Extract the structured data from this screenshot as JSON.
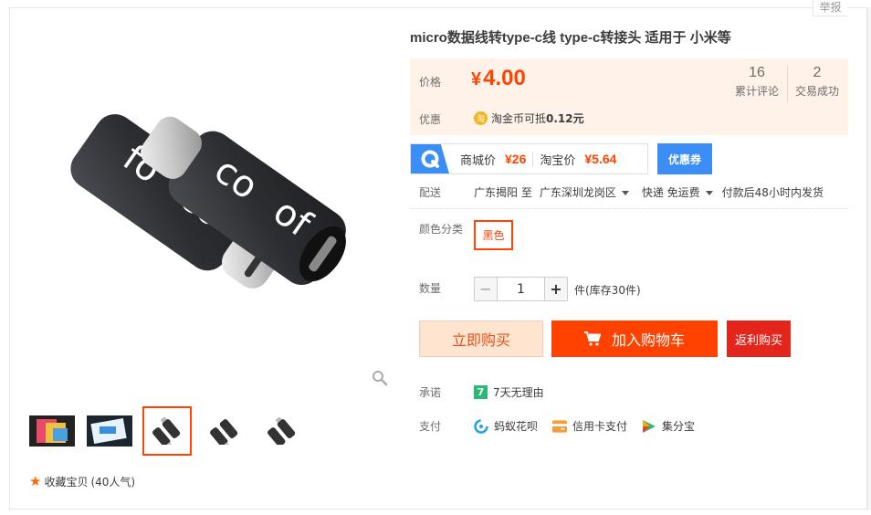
{
  "report_label": "举报",
  "product": {
    "title": "micro数据线转type-c线 type-c转接头 适用于 小米等"
  },
  "gallery": {
    "thumbnails": [
      {
        "name": "thumb-1",
        "active": false
      },
      {
        "name": "thumb-2",
        "active": false
      },
      {
        "name": "thumb-3",
        "active": true
      },
      {
        "name": "thumb-4",
        "active": false
      },
      {
        "name": "thumb-5",
        "active": false
      }
    ],
    "collect_label": "收藏宝贝",
    "collect_count": "(40人气)"
  },
  "price": {
    "label": "价格",
    "currency": "¥",
    "value": "4.00",
    "reviews_count": "16",
    "reviews_label": "累计评论",
    "deals_count": "2",
    "deals_label": "交易成功",
    "promo_label": "优惠",
    "coin_icon": "淘",
    "coin_text": "淘金币可抵",
    "coin_amount": "0.12元"
  },
  "compare": {
    "mall_label": "商城价",
    "mall_price": "¥26",
    "taobao_label": "淘宝价",
    "taobao_price": "¥5.64",
    "coupon_label": "优惠券"
  },
  "delivery": {
    "label": "配送",
    "from": "广东揭阳 至",
    "to": "广东深圳龙岗区",
    "shipping": "快递 免运费",
    "dispatch": "付款后48小时内发货"
  },
  "sku": {
    "label": "颜色分类",
    "selected": "黑色"
  },
  "quantity": {
    "label": "数量",
    "value": "1",
    "minus": "−",
    "plus": "+",
    "stock": "件(库存30件)"
  },
  "actions": {
    "buy_now": "立即购买",
    "add_cart": "加入购物车",
    "rebate": "返利购买"
  },
  "promise": {
    "label": "承诺",
    "icon": "7",
    "text": "7天无理由"
  },
  "payment": {
    "label": "支付",
    "methods": [
      "蚂蚁花呗",
      "信用卡支付",
      "集分宝"
    ]
  },
  "colors": {
    "accent": "#ff4400",
    "price_bg": "#fff2e8",
    "mall_blue": "#3a8ef6",
    "rebate_red": "#e4251b"
  }
}
